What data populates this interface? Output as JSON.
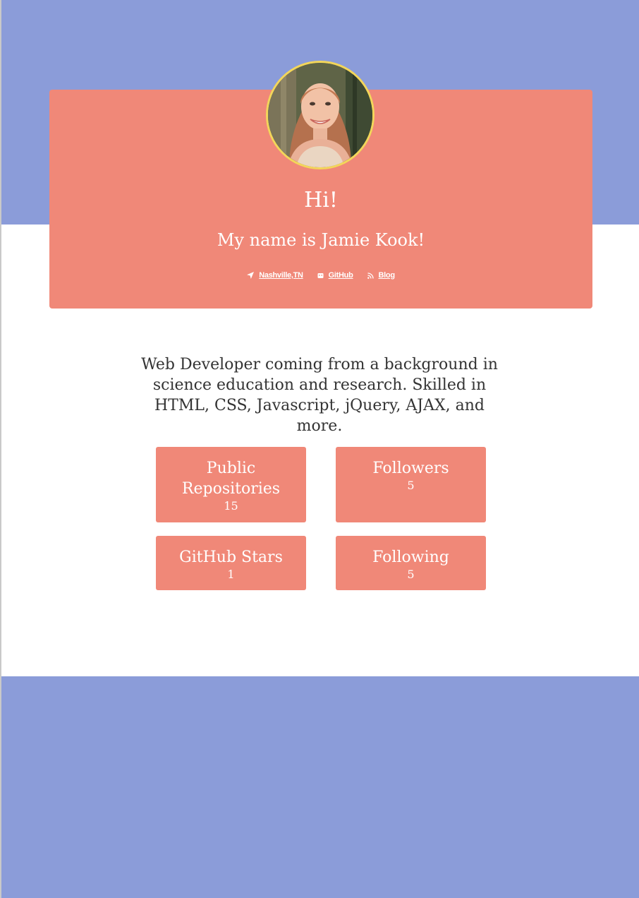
{
  "colors": {
    "band": "#8b9cd9",
    "card": "#f08878",
    "avatar_border": "#f3d65a",
    "text_dark": "#333333",
    "text_light": "#ffffff"
  },
  "profile": {
    "greeting": "Hi!",
    "name_line": "My name is Jamie Kook!",
    "avatar_icon": "profile-photo"
  },
  "links": [
    {
      "icon": "location-arrow-icon",
      "label": "Nashville,TN"
    },
    {
      "icon": "github-icon",
      "label": "GitHub"
    },
    {
      "icon": "rss-icon",
      "label": "Blog"
    }
  ],
  "bio": "Web Developer coming from a background in science education and research. Skilled in HTML, CSS, Javascript, jQuery, AJAX, and more.",
  "stats": {
    "repos": {
      "label": "Public Repositories",
      "value": "15"
    },
    "followers": {
      "label": "Followers",
      "value": "5"
    },
    "stars": {
      "label": "GitHub Stars",
      "value": "1"
    },
    "following": {
      "label": "Following",
      "value": "5"
    }
  }
}
